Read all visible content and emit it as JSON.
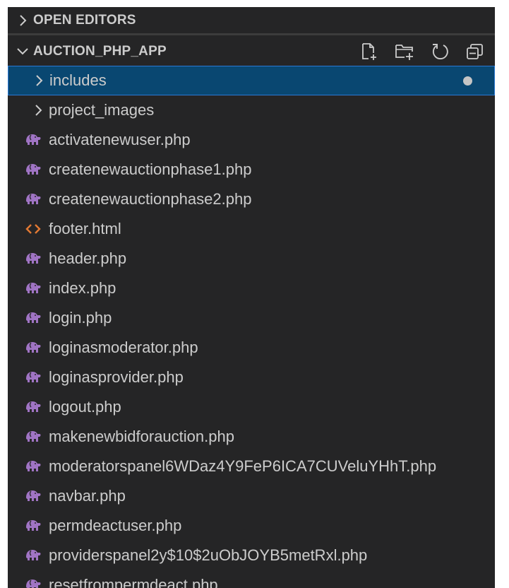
{
  "sections": {
    "open_editors": {
      "label": "OPEN EDITORS"
    },
    "project": {
      "label": "AUCTION_PHP_APP"
    }
  },
  "header_actions": [
    {
      "name": "new-file-icon"
    },
    {
      "name": "new-folder-icon"
    },
    {
      "name": "refresh-icon"
    },
    {
      "name": "collapse-all-icon"
    }
  ],
  "tree": {
    "folders": [
      {
        "label": "includes",
        "selected": true,
        "modified": true
      },
      {
        "label": "project_images"
      }
    ],
    "files": [
      {
        "label": "activatenewuser.php",
        "icon": "php-elephant-icon"
      },
      {
        "label": "createnewauctionphase1.php",
        "icon": "php-elephant-icon"
      },
      {
        "label": "createnewauctionphase2.php",
        "icon": "php-elephant-icon"
      },
      {
        "label": "footer.html",
        "icon": "html-icon"
      },
      {
        "label": "header.php",
        "icon": "php-elephant-icon"
      },
      {
        "label": "index.php",
        "icon": "php-elephant-icon"
      },
      {
        "label": "login.php",
        "icon": "php-elephant-icon"
      },
      {
        "label": "loginasmoderator.php",
        "icon": "php-elephant-icon"
      },
      {
        "label": "loginasprovider.php",
        "icon": "php-elephant-icon"
      },
      {
        "label": "logout.php",
        "icon": "php-elephant-icon"
      },
      {
        "label": "makenewbidforauction.php",
        "icon": "php-elephant-icon"
      },
      {
        "label": "moderatorspanel6WDaz4Y9FeP6ICA7CUVeluYHhT.php",
        "icon": "php-elephant-icon"
      },
      {
        "label": "navbar.php",
        "icon": "php-elephant-icon"
      },
      {
        "label": "permdeactuser.php",
        "icon": "php-elephant-icon"
      },
      {
        "label": "providerspanel2y$10$2uObJOYB5metRxl.php",
        "icon": "php-elephant-icon"
      },
      {
        "label": "resetfrompermdeact.php",
        "icon": "php-elephant-icon"
      }
    ]
  },
  "colors": {
    "background": "#252526",
    "selection": "#094771",
    "selection_border": "#2b79d3",
    "text": "#cccccc",
    "php_icon": "#a074c4",
    "html_icon": "#e37933"
  }
}
